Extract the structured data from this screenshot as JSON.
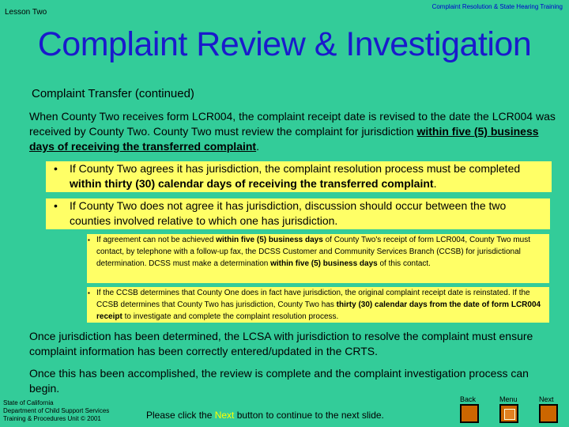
{
  "header": {
    "lesson": "Lesson Two",
    "course": "Complaint Resolution & State Hearing Training",
    "title": "Complaint Review & Investigation",
    "subtitle": "Complaint Transfer  (continued)"
  },
  "intro": {
    "text": "When County Two receives form LCR004, the complaint receipt date is revised to the date the LCR004 was received by County Two.  County Two must review the complaint for jurisdiction ",
    "bold": "within five (5) business days of receiving the transferred complaint",
    "end": "."
  },
  "bullets": [
    {
      "glyph": "•",
      "text": "If County Two agrees it has jurisdiction, the complaint resolution process must be completed ",
      "bold": "within thirty (30) calendar days of receiving the transferred complaint",
      "end": "."
    },
    {
      "glyph": "•",
      "text": "If County Two does not agree it has jurisdiction, discussion should occur between the two counties involved relative to which one has jurisdiction."
    }
  ],
  "sub_bullets": [
    {
      "glyph": "▪",
      "t1": "If agreement can not be achieved ",
      "b1": "within five (5) business days",
      "t2": " of County Two's receipt of form LCR004, County Two must contact, by telephone with a follow-up fax, the DCSS Customer and Community Services Branch (CCSB) for jurisdictional determination.  DCSS must make a determination ",
      "b2": "within five (5) business days",
      "t3": " of this contact."
    },
    {
      "glyph": "▪",
      "t1": "If the CCSB determines that County One does in fact have jurisdiction, the original complaint receipt date is reinstated.  If the CCSB determines that County Two has jurisdiction, County Two has ",
      "b1": "thirty (30) calendar days from the date of form LCR004 receipt",
      "t2": " to investigate and complete the complaint resolution process."
    }
  ],
  "closing": [
    "Once jurisdiction has been determined, the LCSA with jurisdiction to resolve the complaint must ensure complaint information has been correctly entered/updated in the CRTS.",
    "Once this has been accomplished, the review is complete and the complaint investigation process can begin."
  ],
  "footer": {
    "org_line1": "State of California",
    "org_line2": "Department of Child Support Services",
    "org_line3": "Training & Procedures Unit  © 2001",
    "cta_before": "Please click the ",
    "cta_next": "Next",
    "cta_after": " button to continue to the next slide."
  },
  "nav": {
    "back_label": "Back",
    "menu_label": "Menu",
    "next_label": "Next"
  },
  "colors": {
    "background": "#33cc99",
    "title": "#1a1acc",
    "highlight": "#ffff66",
    "nav_button": "#cc6600"
  }
}
